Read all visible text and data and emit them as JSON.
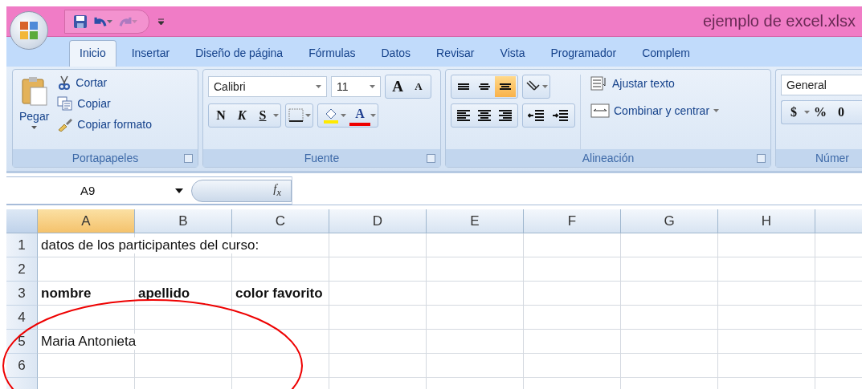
{
  "window": {
    "title": "ejemplo de excel.xlsx",
    "quick_access": [
      {
        "kind": "save",
        "disabled": false
      },
      {
        "kind": "undo",
        "disabled": false
      },
      {
        "kind": "redo",
        "disabled": true
      }
    ]
  },
  "tabs": [
    {
      "label": "Inicio",
      "selected": true
    },
    {
      "label": "Insertar",
      "selected": false
    },
    {
      "label": "Diseño de página",
      "selected": false
    },
    {
      "label": "Fórmulas",
      "selected": false
    },
    {
      "label": "Datos",
      "selected": false
    },
    {
      "label": "Revisar",
      "selected": false
    },
    {
      "label": "Vista",
      "selected": false
    },
    {
      "label": "Programador",
      "selected": false
    },
    {
      "label": "Complem",
      "selected": false
    }
  ],
  "ribbon": {
    "clipboard": {
      "label": "Portapapeles",
      "paste": "Pegar",
      "items": [
        {
          "kind": "cut",
          "label": "Cortar"
        },
        {
          "kind": "copy",
          "label": "Copiar"
        },
        {
          "kind": "format",
          "label": "Copiar formato"
        }
      ]
    },
    "font": {
      "label": "Fuente",
      "font_name": "Calibri",
      "font_size": "11",
      "grow": "A",
      "shrink": "A",
      "bold": "N",
      "italic": "K",
      "underline": "S",
      "font_color": "A"
    },
    "alignment": {
      "label": "Alineación",
      "vertical": [
        {
          "kind": "top",
          "selected": false
        },
        {
          "kind": "middle",
          "selected": false
        },
        {
          "kind": "bottom",
          "selected": true
        }
      ],
      "horizontal": [
        {
          "kind": "left",
          "selected": false
        },
        {
          "kind": "center",
          "selected": false
        },
        {
          "kind": "right",
          "selected": false
        }
      ],
      "wrap": "Ajustar texto",
      "merge": "Combinar y centrar"
    },
    "number": {
      "label": "Númer",
      "format": "General",
      "currency": "$",
      "percent": "%",
      "thousands": "0"
    }
  },
  "formula_bar": {
    "name_box": "A9",
    "fx": "f$_{x}$"
  },
  "sheet": {
    "columns": [
      {
        "label": "A",
        "selected": true
      },
      {
        "label": "B",
        "selected": false
      },
      {
        "label": "C",
        "selected": false
      },
      {
        "label": "D",
        "selected": false
      },
      {
        "label": "E",
        "selected": false
      },
      {
        "label": "F",
        "selected": false
      },
      {
        "label": "G",
        "selected": false
      },
      {
        "label": "H",
        "selected": false
      }
    ],
    "rows": [
      {
        "number": "1",
        "cells": [
          {
            "text": "datos de los participantes del curso:",
            "bold": false
          }
        ]
      },
      {
        "number": "2"
      },
      {
        "number": "3",
        "cells": [
          {
            "text": "nombre",
            "bold": true
          },
          {
            "text": "apellido",
            "bold": true
          },
          {
            "text": "color favorito",
            "bold": true
          }
        ]
      },
      {
        "number": "4"
      },
      {
        "number": "5",
        "cells": [
          {
            "text": "Maria Antonieta",
            "bold": false
          }
        ]
      },
      {
        "number": "6"
      }
    ]
  }
}
